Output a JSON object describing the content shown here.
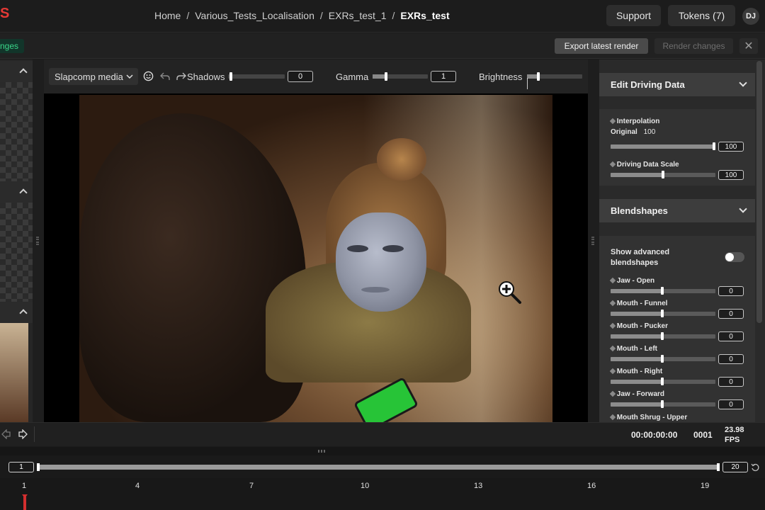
{
  "brand": "S",
  "breadcrumb": {
    "home": "Home",
    "project": "Various_Tests_Localisation",
    "shot": "EXRs_test_1",
    "current": "EXRs_test",
    "separator": "/"
  },
  "header": {
    "support_label": "Support",
    "tokens_label": "Tokens (7)",
    "avatar_initials": "DJ"
  },
  "actions": {
    "changes_badge": "nges",
    "export_label": "Export latest render",
    "render_label": "Render changes",
    "close_glyph": "✕"
  },
  "viewer_toolbar": {
    "media_select": "Slapcomp media",
    "shadows": {
      "label": "Shadows",
      "value": "0"
    },
    "gamma": {
      "label": "Gamma",
      "value": "1"
    },
    "brightness": {
      "label": "Brightness"
    }
  },
  "panel": {
    "edit_driving": {
      "title": "Edit Driving Data",
      "interpolation": {
        "label": "Interpolation",
        "sub_label": "Original",
        "sub_value": "100",
        "value": "100",
        "level": 1.0
      },
      "scale": {
        "label": "Driving Data Scale",
        "value": "100",
        "level": 0.5
      }
    },
    "blendshapes": {
      "title": "Blendshapes",
      "advanced_label": "Show advanced blendshapes",
      "advanced_on": false,
      "items": [
        {
          "label": "Jaw - Open",
          "value": "0"
        },
        {
          "label": "Mouth - Funnel",
          "value": "0"
        },
        {
          "label": "Mouth - Pucker",
          "value": "0"
        },
        {
          "label": "Mouth - Left",
          "value": "0"
        },
        {
          "label": "Mouth - Right",
          "value": "0"
        },
        {
          "label": "Jaw - Forward",
          "value": "0"
        },
        {
          "label": "Mouth Shrug - Upper",
          "value": ""
        }
      ]
    }
  },
  "playback": {
    "timecode": "00:00:00:00",
    "frame": "0001",
    "fps_value": "23.98",
    "fps_unit": "FPS"
  },
  "timeline": {
    "start": "1",
    "end": "20",
    "ticks": [
      "1",
      "4",
      "7",
      "10",
      "13",
      "16",
      "19"
    ],
    "current_frame": 1
  },
  "icons": {
    "smile": "smile-icon",
    "undo": "undo-icon",
    "redo": "redo-icon",
    "zoom": "zoom-in-icon",
    "reset": "reset-icon"
  },
  "colors": {
    "accent_red": "#e53935",
    "success_green": "#3ad68a",
    "playhead": "#d32f2f"
  }
}
